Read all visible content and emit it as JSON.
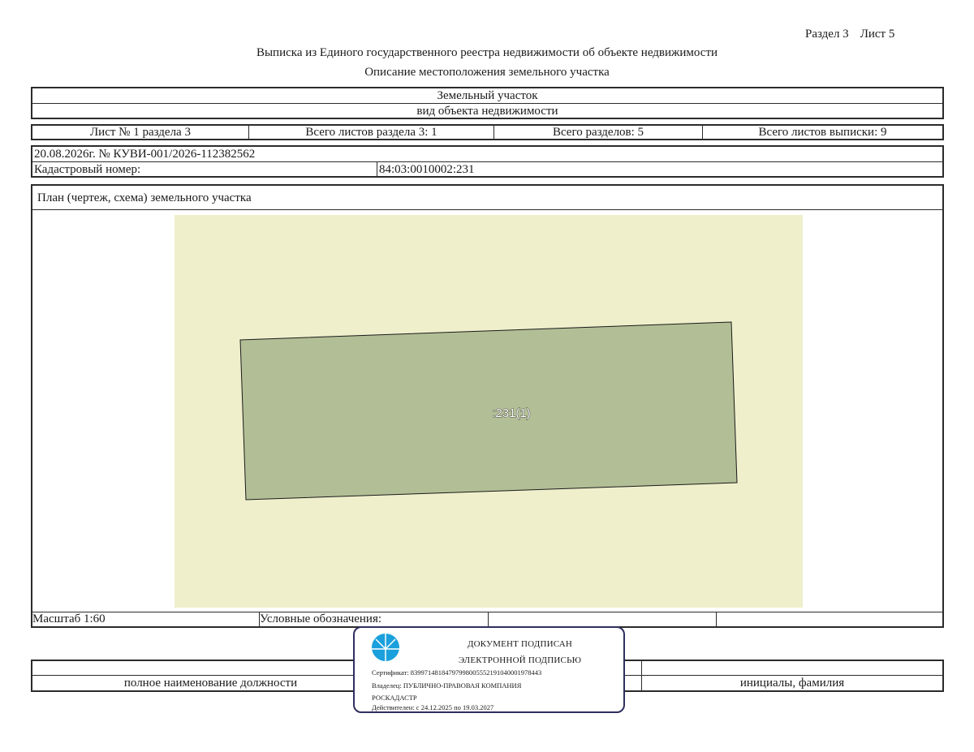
{
  "header": {
    "section": "Раздел 3",
    "sheet": "Лист 5",
    "title": "Выписка из Единого государственного реестра недвижимости об объекте недвижимости",
    "subtitle": "Описание местоположения земельного участка"
  },
  "object": {
    "name": "Земельный участок",
    "type_caption": "вид объекта недвижимости"
  },
  "sheets": {
    "sheet_of_section": "Лист № 1 раздела 3",
    "total_section_sheets": "Всего листов раздела 3: 1",
    "total_sections": "Всего разделов: 5",
    "total_extract_sheets": "Всего листов выписки: 9"
  },
  "meta": {
    "date_number": "20.08.2026г. № КУВИ-001/2026-112382562",
    "cadastral_label": "Кадастровый номер:",
    "cadastral_value": "84:03:0010002:231"
  },
  "plan": {
    "heading": "План (чертеж, схема) земельного участка",
    "parcel_label": ":231(1)",
    "background_color": "#efefcc",
    "parcel_color": "#b2bf96",
    "scale": "Масштаб 1:60",
    "legend_label": "Условные обозначения:"
  },
  "signature": {
    "position_caption": "полное наименование должности",
    "name_caption": "инициалы, фамилия"
  },
  "stamp": {
    "line1": "ДОКУМЕНТ ПОДПИСАН",
    "line2": "ЭЛЕКТРОННОЙ ПОДПИСЬЮ",
    "certificate": "Сертификат: 83997148184797998005552191040001978443",
    "owner_line1": "Владелец: ПУБЛИЧНО-ПРАВОВАЯ КОМПАНИЯ",
    "owner_line2": "РОСКАДАСТР",
    "valid": "Действителен: с 24.12.2025 по 19.03.2027",
    "border_color": "#2e2f5e",
    "emblem_color": "#1aa0dc",
    "emblem_icon": "roskadastr-emblem-icon"
  }
}
